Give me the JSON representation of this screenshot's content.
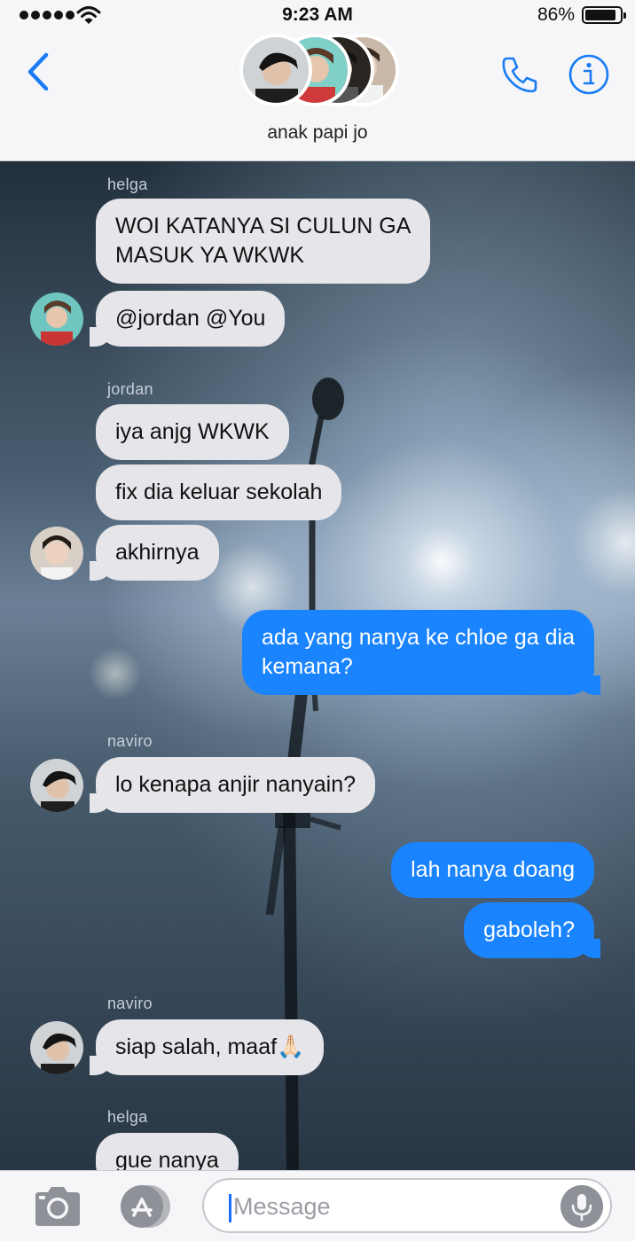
{
  "status_bar": {
    "time": "9:23 AM",
    "battery": "86%"
  },
  "header": {
    "group_name": "anak papi jo"
  },
  "messages": {
    "m1_sender": "helga",
    "m1_line1": "WOI KATANYA SI CULUN GA",
    "m1_line2": "MASUK YA WKWK",
    "m2": "@jordan @You",
    "m3_sender": "jordan",
    "m3": "iya anjg WKWK",
    "m4": "fix dia keluar sekolah",
    "m5": "akhirnya",
    "m6_line1": "ada yang nanya ke chloe ga dia",
    "m6_line2": "kemana?",
    "m7_sender": "naviro",
    "m7": "lo kenapa anjir nanyain?",
    "m8": "lah nanya doang",
    "m9": "gaboleh?",
    "m10_sender": "naviro",
    "m10": "siap salah, maaf🙏🏻",
    "m11_sender": "helga",
    "m11": "gue nanya"
  },
  "composer": {
    "placeholder": "Message"
  },
  "colors": {
    "incoming_bubble": "#e6e5ea",
    "outgoing_bubble": "#1a84ff",
    "accent": "#1a7cf5"
  }
}
